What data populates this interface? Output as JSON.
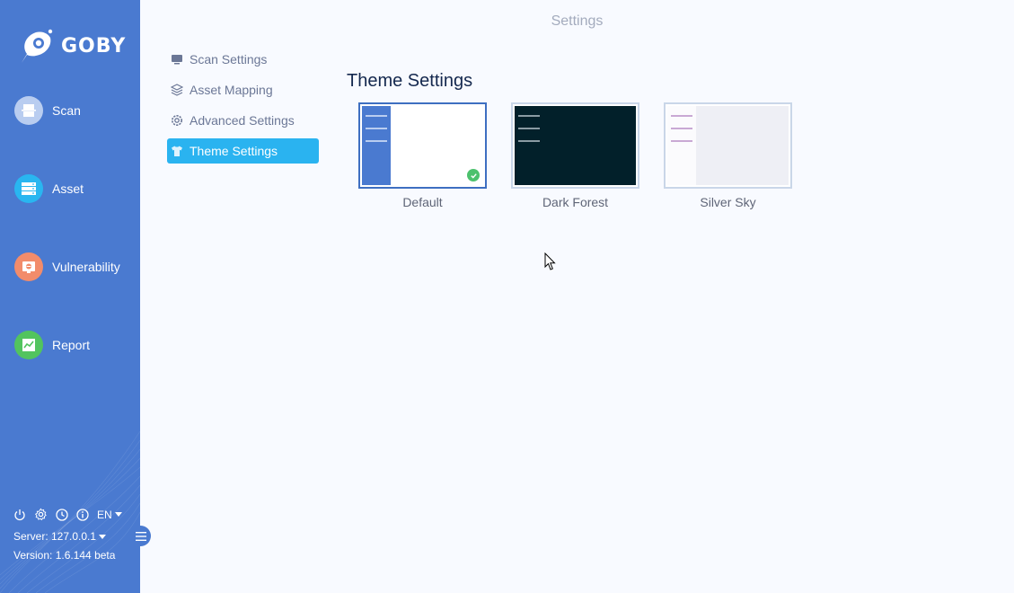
{
  "app": {
    "logo_text": "GOBY"
  },
  "nav": [
    {
      "label": "Scan",
      "icon": "scan-icon",
      "color": "#b9cdf0"
    },
    {
      "label": "Asset",
      "icon": "asset-icon",
      "color": "#29b6f0"
    },
    {
      "label": "Vulnerability",
      "icon": "vulnerability-icon",
      "color": "#f28c6b"
    },
    {
      "label": "Report",
      "icon": "report-icon",
      "color": "#52c45e"
    }
  ],
  "footer": {
    "language": "EN",
    "server": "Server: 127.0.0.1",
    "version": "Version: 1.6.144 beta"
  },
  "header": {
    "title": "Settings"
  },
  "settings_menu": [
    {
      "label": "Scan Settings",
      "icon": "monitor-icon"
    },
    {
      "label": "Asset Mapping",
      "icon": "layers-icon"
    },
    {
      "label": "Advanced Settings",
      "icon": "gear-icon"
    },
    {
      "label": "Theme Settings",
      "icon": "shirt-icon",
      "active": true
    }
  ],
  "theme_section": {
    "title": "Theme Settings",
    "themes": [
      {
        "name": "Default",
        "selected": true
      },
      {
        "name": "Dark Forest",
        "selected": false
      },
      {
        "name": "Silver Sky",
        "selected": false
      }
    ]
  },
  "colors": {
    "sidebar": "#4a7ad0",
    "active_menu": "#2ab3f0",
    "selected_border": "#3e6fc1",
    "check": "#4cc16d"
  }
}
